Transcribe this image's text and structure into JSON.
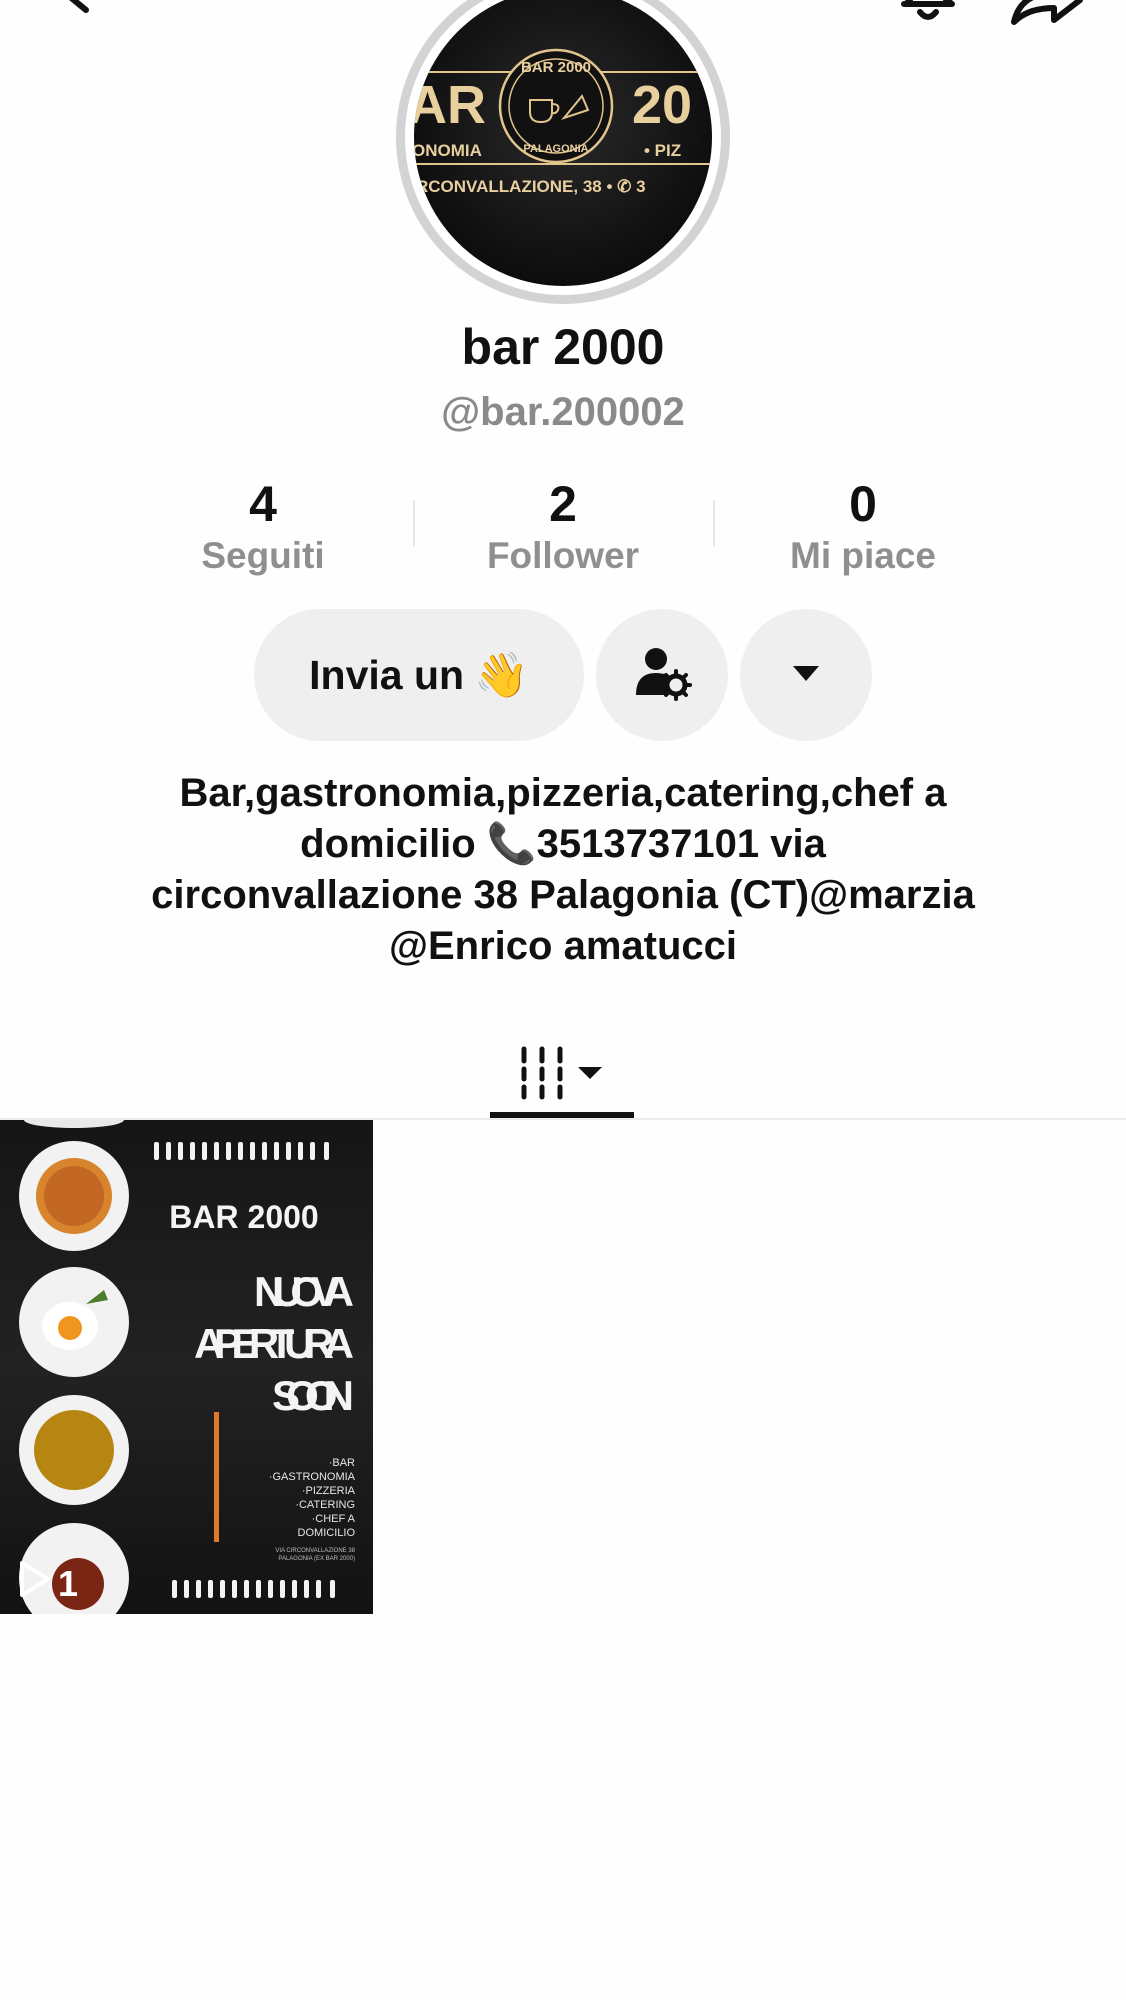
{
  "profile": {
    "display_name": "bar 2000",
    "username": "@bar.200002",
    "avatar": {
      "line1_left": "AR",
      "line1_right": "20",
      "seal_top": "BAR 2000",
      "seal_bottom": "PALAGONIA",
      "line2_left": "ONOMIA",
      "line2_right": "• PIZ",
      "line3": "RCONVALLAZIONE, 38 • ✆ 3"
    }
  },
  "stats": [
    {
      "value": "4",
      "label": "Seguiti"
    },
    {
      "value": "2",
      "label": "Follower"
    },
    {
      "value": "0",
      "label": "Mi piace"
    }
  ],
  "actions": {
    "wave_label": "Invia un",
    "wave_emoji": "👋"
  },
  "bio": {
    "line1": "Bar,gastronomia,pizzeria,catering,chef a",
    "line2": "domicilio 📞3513737101 via",
    "line3": "circonvallazione 38 Palagonia (CT)",
    "mention1": "@marzia",
    "mention2": "@Enrico amatucci"
  },
  "videos": [
    {
      "brand": "BAR 2000",
      "headline": [
        "NUOVA",
        "APERTURA",
        "SOON"
      ],
      "services": [
        "·BAR",
        "·GASTRONOMIA",
        "·PIZZERIA",
        "·CATERING",
        "·CHEF A",
        "DOMICILIO"
      ],
      "address_small": [
        "VIA CIRCONVALLAZIONE 38",
        "PALAGONIA (EX BAR 2000)"
      ],
      "play_count": "1"
    }
  ],
  "icons": [
    "back-icon",
    "bell-icon",
    "share-icon",
    "user-settings-icon",
    "caret-down-icon",
    "grid-menu-icon",
    "play-icon"
  ],
  "colors": {
    "button_bg": "#efefef",
    "muted_text": "#8a8a8a",
    "avatar_gold": "#e2c48d",
    "accent_orange": "#e07a2a"
  }
}
